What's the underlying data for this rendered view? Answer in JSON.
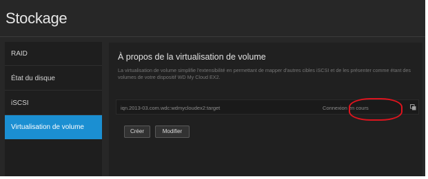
{
  "app": {
    "title": "Stockage"
  },
  "sidebar": {
    "items": [
      {
        "label": "RAID",
        "active": false
      },
      {
        "label": "État du disque",
        "active": false
      },
      {
        "label": "iSCSI",
        "active": false
      },
      {
        "label": "Virtualisation de volume",
        "active": true
      }
    ]
  },
  "main": {
    "heading": "À propos de la virtualisation de volume",
    "description": "La virtualisation de volume simplifie l'extensibilité en permettant de mapper d'autres cibles iSCSI et de les présenter comme étant des volumes de votre dispositif WD My Cloud EX2.",
    "target": {
      "name": "iqn.2013-03.com.wdc:wdmycloudex2:target",
      "status": "Connexion en cours",
      "icon": "copy-icon"
    },
    "buttons": {
      "create": "Créer",
      "edit": "Modifier"
    }
  },
  "colors": {
    "accent": "#1b8fd2",
    "annotation": "#e0141e",
    "background": "#272727"
  }
}
